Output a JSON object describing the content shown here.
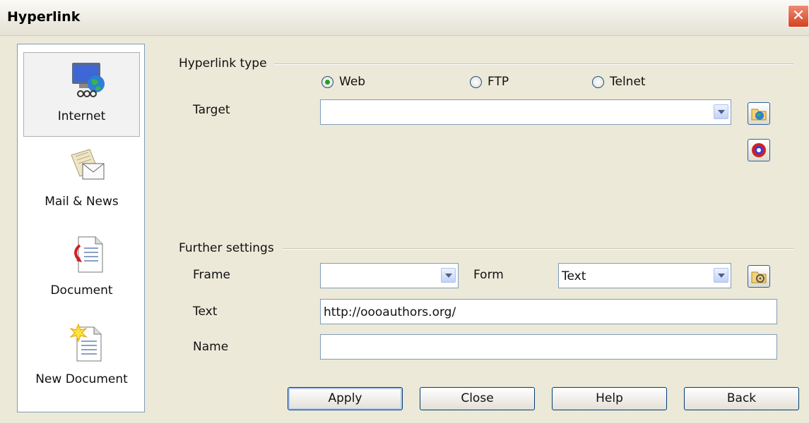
{
  "window": {
    "title": "Hyperlink",
    "close_symbol": "✕"
  },
  "sidebar": {
    "items": [
      {
        "label": "Internet",
        "icon": "internet-icon",
        "selected": true
      },
      {
        "label": "Mail & News",
        "icon": "mail-news-icon",
        "selected": false
      },
      {
        "label": "Document",
        "icon": "document-icon",
        "selected": false
      },
      {
        "label": "New Document",
        "icon": "new-document-icon",
        "selected": false
      }
    ]
  },
  "hyperlink_type": {
    "heading": "Hyperlink type",
    "options": [
      {
        "label": "Web",
        "selected": true
      },
      {
        "label": "FTP",
        "selected": false
      },
      {
        "label": "Telnet",
        "selected": false
      }
    ],
    "target_label": "Target",
    "target_value": ""
  },
  "further_settings": {
    "heading": "Further settings",
    "frame_label": "Frame",
    "frame_value": "",
    "form_label": "Form",
    "form_value": "Text",
    "text_label": "Text",
    "text_value": "http://oooauthors.org/",
    "name_label": "Name",
    "name_value": ""
  },
  "buttons": {
    "apply": "Apply",
    "close": "Close",
    "help": "Help",
    "back": "Back"
  },
  "colors": {
    "dialog_bg": "#ece9d8",
    "field_border": "#7f9db9",
    "button_border": "#003c74"
  }
}
